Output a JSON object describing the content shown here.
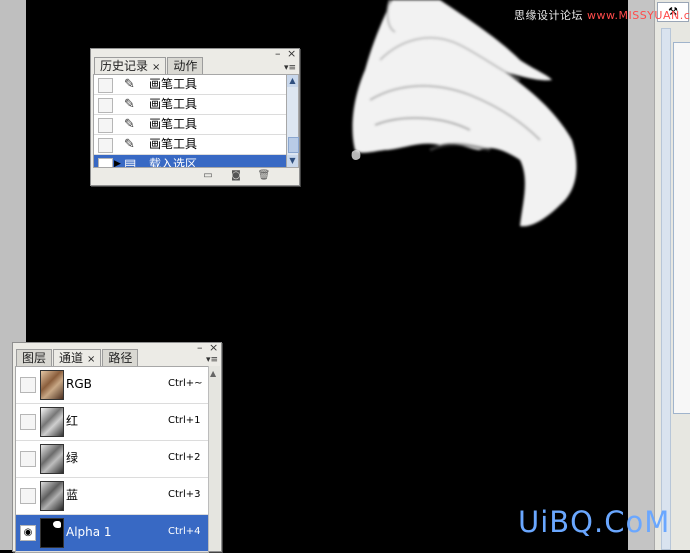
{
  "watermark": {
    "top_prefix": "思缘设计论坛",
    "top_site": "www.MISSYUAN.com",
    "bottom": "UiBQ.CoM"
  },
  "history_panel": {
    "tabs": [
      {
        "label": "历史记录",
        "active": true,
        "closable": true
      },
      {
        "label": "动作",
        "active": false,
        "closable": false
      }
    ],
    "items": [
      {
        "label": "画笔工具",
        "icon": "brush-icon",
        "selected": false
      },
      {
        "label": "画笔工具",
        "icon": "brush-icon",
        "selected": false
      },
      {
        "label": "画笔工具",
        "icon": "brush-icon",
        "selected": false
      },
      {
        "label": "画笔工具",
        "icon": "brush-icon",
        "selected": false
      },
      {
        "label": "载入选区",
        "icon": "load-selection-icon",
        "selected": true
      }
    ],
    "footer_icons": [
      "new-document-icon",
      "snapshot-camera-icon",
      "trash-icon"
    ]
  },
  "channels_panel": {
    "tabs": [
      {
        "label": "图层",
        "active": false,
        "closable": false
      },
      {
        "label": "通道",
        "active": true,
        "closable": true
      },
      {
        "label": "路径",
        "active": false,
        "closable": false
      }
    ],
    "channels": [
      {
        "name": "RGB",
        "shortcut": "Ctrl+~",
        "visible": false,
        "selected": false,
        "thumb": "rgb"
      },
      {
        "name": "红",
        "shortcut": "Ctrl+1",
        "visible": false,
        "selected": false,
        "thumb": "gray1"
      },
      {
        "name": "绿",
        "shortcut": "Ctrl+2",
        "visible": false,
        "selected": false,
        "thumb": "gray2"
      },
      {
        "name": "蓝",
        "shortcut": "Ctrl+3",
        "visible": false,
        "selected": false,
        "thumb": "gray3"
      },
      {
        "name": "Alpha 1",
        "shortcut": "Ctrl+4",
        "visible": true,
        "selected": true,
        "thumb": "alpha"
      }
    ]
  },
  "colors": {
    "selection": "#3869c4",
    "panel_bg": "#ecebe6",
    "canvas_bg": "#000000",
    "watermark_blue": "#6aa7ff"
  }
}
